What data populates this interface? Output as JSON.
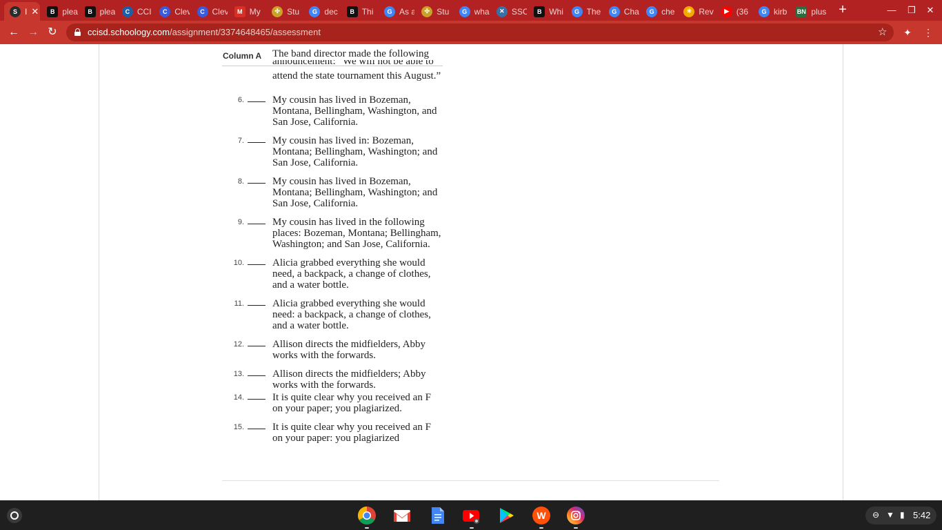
{
  "browser": {
    "tabs": [
      {
        "label": "I",
        "icon": "schoology-icon",
        "color": "#2b2b2b",
        "letter": "S",
        "active": true
      },
      {
        "label": "plea",
        "icon": "brainly-icon",
        "color": "#111111",
        "letter": "B"
      },
      {
        "label": "plea",
        "icon": "brainly-icon",
        "color": "#111111",
        "letter": "B"
      },
      {
        "label": "CCI",
        "icon": "clever-portal-icon",
        "color": "#1b5fa8",
        "letter": "C"
      },
      {
        "label": "Clev",
        "icon": "clever-icon",
        "color": "#3b5bdb",
        "letter": "C"
      },
      {
        "label": "Clev",
        "icon": "clever-icon",
        "color": "#3b5bdb",
        "letter": "C"
      },
      {
        "label": "My",
        "icon": "gmail-icon",
        "color": "#d93025",
        "letter": "M"
      },
      {
        "label": "Stu",
        "icon": "studylib-icon",
        "color": "#c9a227",
        "letter": "✣"
      },
      {
        "label": "dec",
        "icon": "google-icon",
        "color": "#4285f4",
        "letter": "G"
      },
      {
        "label": "Thi",
        "icon": "brainly-icon",
        "color": "#111111",
        "letter": "B"
      },
      {
        "label": "As a",
        "icon": "google-icon",
        "color": "#4285f4",
        "letter": "G"
      },
      {
        "label": "Stu",
        "icon": "studylib-icon",
        "color": "#c9a227",
        "letter": "✣"
      },
      {
        "label": "wha",
        "icon": "google-icon",
        "color": "#4285f4",
        "letter": "G"
      },
      {
        "label": "SSC",
        "icon": "ssc-icon",
        "color": "#3a6ea5",
        "letter": "✕"
      },
      {
        "label": "Whi",
        "icon": "brainly-icon",
        "color": "#111111",
        "letter": "B"
      },
      {
        "label": "The",
        "icon": "google-icon",
        "color": "#4285f4",
        "letter": "G"
      },
      {
        "label": "Cha",
        "icon": "google-icon",
        "color": "#4285f4",
        "letter": "G"
      },
      {
        "label": "che",
        "icon": "google-icon",
        "color": "#4285f4",
        "letter": "G"
      },
      {
        "label": "Rev",
        "icon": "walmart-icon",
        "color": "#f2a900",
        "letter": "✳"
      },
      {
        "label": "(36",
        "icon": "youtube-icon",
        "color": "#ff0000",
        "letter": "▶"
      },
      {
        "label": "kirb",
        "icon": "google-icon",
        "color": "#4285f4",
        "letter": "G"
      },
      {
        "label": "plus",
        "icon": "bn-icon",
        "color": "#2e6b3f",
        "letter": "BN"
      }
    ],
    "url_domain": "ccisd.schoology.com",
    "url_path": "/assignment/3374648465/assessment"
  },
  "assessment": {
    "column_header": "Column A",
    "previous_item_cut_top": "The band director made the following",
    "previous_item_cut_mid": "announcement: “We will not be able to",
    "previous_item_last_line": "attend the state tournament this August.”",
    "items": [
      {
        "number": "6.",
        "text": "My cousin has lived in Bozeman, Montana, Bellingham, Washington, and San Jose, California."
      },
      {
        "number": "7.",
        "text": " My cousin has lived in: Bozeman, Montana; Bellingham, Washington; and San Jose, California."
      },
      {
        "number": "8.",
        "text": "My cousin has lived in Bozeman, Montana; Bellingham, Washington; and San Jose, California."
      },
      {
        "number": "9.",
        "text": "My cousin has lived in the following places: Bozeman, Montana; Bellingham, Washington; and San Jose, California."
      },
      {
        "number": "10.",
        "text": " Alicia grabbed everything she would need, a backpack, a change of clothes, and a water bottle."
      },
      {
        "number": "11.",
        "text": "Alicia grabbed everything she would need: a backpack, a change of clothes, and a water bottle."
      },
      {
        "number": "12.",
        "text": "Allison directs the midfielders, Abby works with the forwards."
      },
      {
        "number": "13.",
        "text": "Allison directs the midfielders; Abby works with the forwards."
      },
      {
        "number": "14.",
        "text": "It is quite clear why you received an F on your paper; you plagiarized."
      },
      {
        "number": "15.",
        "text": "It is quite clear why you received an F on your paper: you plagiarized"
      }
    ]
  },
  "shelf": {
    "apps": [
      "chrome-icon",
      "gmail-icon",
      "google-docs-icon",
      "youtube-icon",
      "play-store-icon",
      "wattpad-icon",
      "instagram-icon"
    ],
    "clock": "5:42"
  }
}
